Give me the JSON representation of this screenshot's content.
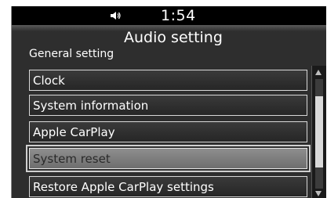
{
  "status_bar": {
    "icon": "volume-icon",
    "time": "1:54"
  },
  "header": {
    "title": "Audio setting"
  },
  "section": {
    "label": "General setting"
  },
  "menu": {
    "items": [
      {
        "label": "Clock",
        "selected": false
      },
      {
        "label": "System information",
        "selected": false
      },
      {
        "label": "Apple CarPlay",
        "selected": false
      },
      {
        "label": "System reset",
        "selected": true
      },
      {
        "label": "Restore Apple CarPlay settings",
        "selected": false
      }
    ]
  },
  "scrollbar": {
    "position_fraction": 0.45,
    "visible_fraction": 0.65
  },
  "colors": {
    "screen_background": "#2e2e2e",
    "selected_background": "#7e7e7e",
    "text": "#ffffff"
  }
}
